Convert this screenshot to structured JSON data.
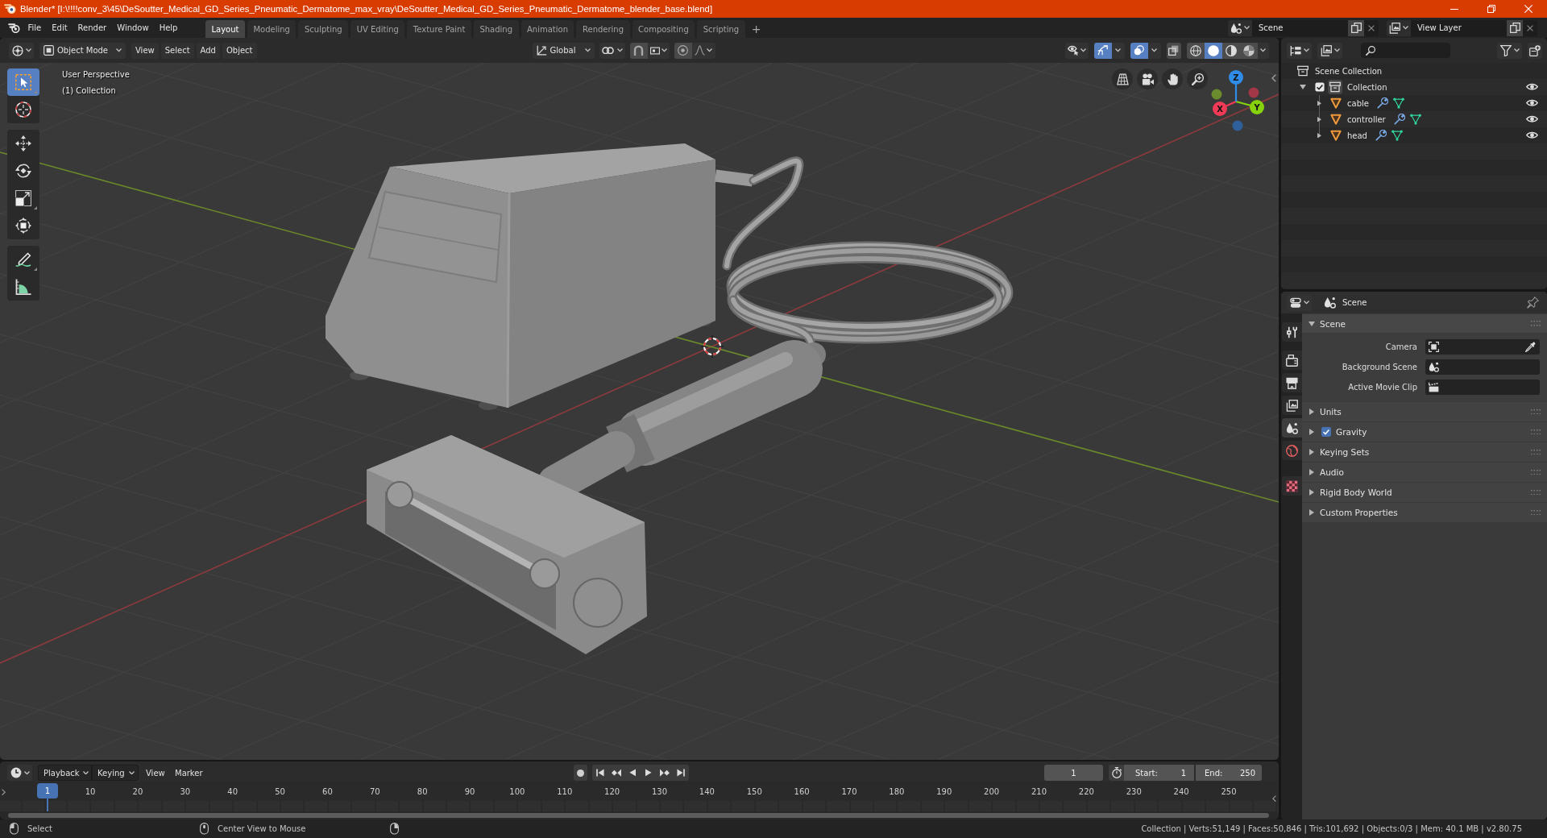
{
  "window": {
    "title": "Blender* [I:\\!!!!conv_3\\45\\DeSoutter_Medical_GD_Series_Pneumatic_Dermatome_max_vray\\DeSoutter_Medical_GD_Series_Pneumatic_Dermatome_blender_base.blend]"
  },
  "menu_bar": [
    "File",
    "Edit",
    "Render",
    "Window",
    "Help"
  ],
  "workspaces": [
    {
      "label": "Layout",
      "selected": true
    },
    {
      "label": "Modeling",
      "selected": false
    },
    {
      "label": "Sculpting",
      "selected": false
    },
    {
      "label": "UV Editing",
      "selected": false
    },
    {
      "label": "Texture Paint",
      "selected": false
    },
    {
      "label": "Shading",
      "selected": false
    },
    {
      "label": "Animation",
      "selected": false
    },
    {
      "label": "Rendering",
      "selected": false
    },
    {
      "label": "Compositing",
      "selected": false
    },
    {
      "label": "Scripting",
      "selected": false
    }
  ],
  "add_workspace": "+",
  "scene": {
    "value": "Scene"
  },
  "view_layer": {
    "value": "View Layer"
  },
  "viewport": {
    "mode": "Object Mode",
    "menus": [
      "View",
      "Select",
      "Add",
      "Object"
    ],
    "orientation": "Global",
    "snap": {
      "on": false
    },
    "proportional": {
      "on": false
    },
    "toggles": [
      {
        "kind": "gizmo",
        "on": true
      },
      {
        "kind": "overlay",
        "on": true
      },
      {
        "kind": "xray",
        "on": false
      }
    ],
    "shading": [
      {
        "kind": "wireframe",
        "selected": false
      },
      {
        "kind": "solid",
        "selected": true
      },
      {
        "kind": "material",
        "selected": false
      },
      {
        "kind": "rendered",
        "selected": false
      }
    ],
    "tools": [
      [
        {
          "kind": "select",
          "selected": true,
          "variants": true
        },
        {
          "kind": "cursor",
          "selected": false,
          "variants": false
        }
      ],
      [
        {
          "kind": "move",
          "selected": false,
          "variants": false
        },
        {
          "kind": "rotate",
          "selected": false,
          "variants": false
        },
        {
          "kind": "scale",
          "selected": false,
          "variants": true
        },
        {
          "kind": "transform",
          "selected": false,
          "variants": false
        }
      ],
      [
        {
          "kind": "annotate",
          "selected": false,
          "variants": true
        },
        {
          "kind": "measure",
          "selected": false,
          "variants": false
        }
      ]
    ],
    "info": [
      "User Perspective",
      "(1) Collection"
    ],
    "gizmo": {
      "axes": [
        {
          "label": "X",
          "color": "#f03a56"
        },
        {
          "label": "Y",
          "color": "#86d30d"
        },
        {
          "label": "Z",
          "color": "#2f8ce8"
        }
      ],
      "negative_axes": [
        {
          "color": "#a13747"
        },
        {
          "color": "#6a8c2c"
        },
        {
          "color": "#2f5f9a"
        }
      ]
    }
  },
  "outliner": {
    "root": "Scene Collection",
    "collections": [
      {
        "name": "Collection",
        "checked": true,
        "expanded": true,
        "active": true,
        "visible": true,
        "children": [
          {
            "name": "cable",
            "expanded": false,
            "visible": true
          },
          {
            "name": "controller",
            "expanded": false,
            "visible": true
          },
          {
            "name": "head",
            "expanded": false,
            "visible": true
          }
        ]
      }
    ]
  },
  "properties": {
    "context": "Scene",
    "tabs": [
      [
        {
          "kind": "tool",
          "selected": false
        }
      ],
      [
        {
          "kind": "render",
          "selected": false
        },
        {
          "kind": "output",
          "selected": false
        },
        {
          "kind": "view_layer",
          "selected": false
        },
        {
          "kind": "scene",
          "selected": true
        },
        {
          "kind": "world",
          "selected": false
        }
      ],
      [
        {
          "kind": "texture",
          "selected": false
        }
      ]
    ],
    "panels": [
      {
        "title": "Scene",
        "expanded": true,
        "fields": [
          {
            "label": "Camera",
            "kind": "camera"
          },
          {
            "label": "Background Scene",
            "kind": "scene"
          },
          {
            "label": "Active Movie Clip",
            "kind": "clip"
          }
        ]
      },
      {
        "title": "Units",
        "expanded": false
      },
      {
        "title": "Gravity",
        "expanded": false,
        "checked": true
      },
      {
        "title": "Keying Sets",
        "expanded": false
      },
      {
        "title": "Audio",
        "expanded": false
      },
      {
        "title": "Rigid Body World",
        "expanded": false
      },
      {
        "title": "Custom Properties",
        "expanded": false
      }
    ]
  },
  "timeline": {
    "menus": [
      {
        "label": "Playback",
        "dropdown": true
      },
      {
        "label": "Keying",
        "dropdown": true
      },
      {
        "label": "View",
        "dropdown": false
      },
      {
        "label": "Marker",
        "dropdown": false
      }
    ],
    "auto_keying": {
      "on": false
    },
    "current_frame": "1",
    "start": {
      "label": "Start:",
      "value": "1"
    },
    "end": {
      "label": "End:",
      "value": "250"
    },
    "playhead": "1",
    "ruler": [
      "10",
      "20",
      "30",
      "40",
      "50",
      "60",
      "70",
      "80",
      "90",
      "100",
      "110",
      "120",
      "130",
      "140",
      "150",
      "160",
      "170",
      "180",
      "190",
      "200",
      "210",
      "220",
      "230",
      "240",
      "250"
    ]
  },
  "status_bar": {
    "hints": [
      "Select",
      "Center View to Mouse"
    ],
    "stats": "Collection | Verts:51,149 | Faces:50,846 | Tris:101,692 | Objects:0/3 | Mem: 40.1 MB | v2.80.75"
  }
}
